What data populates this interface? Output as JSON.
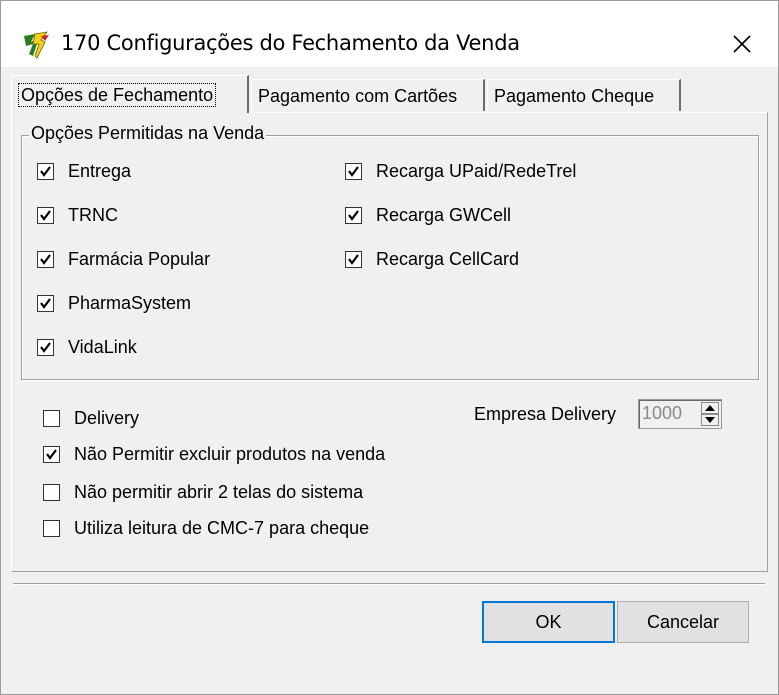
{
  "window": {
    "title": "170 Configurações do Fechamento da Venda"
  },
  "tabs": [
    {
      "label": "Opções de Fechamento",
      "active": true
    },
    {
      "label": "Pagamento com Cartões",
      "active": false
    },
    {
      "label": "Pagamento Cheque",
      "active": false
    }
  ],
  "group": {
    "legend": "Opções Permitidas na Venda",
    "left_options": [
      {
        "label": "Entrega",
        "checked": true
      },
      {
        "label": "TRNC",
        "checked": true
      },
      {
        "label": "Farmácia Popular",
        "checked": true
      },
      {
        "label": "PharmaSystem",
        "checked": true
      },
      {
        "label": "VidaLink",
        "checked": true
      }
    ],
    "right_options": [
      {
        "label": "Recarga UPaid/RedeTrel",
        "checked": true
      },
      {
        "label": "Recarga GWCell",
        "checked": true
      },
      {
        "label": "Recarga CellCard",
        "checked": true
      }
    ]
  },
  "options": [
    {
      "label": "Delivery",
      "checked": false
    },
    {
      "label": "Não Permitir excluir produtos na venda",
      "checked": true
    },
    {
      "label": "Não permitir abrir 2 telas do sistema",
      "checked": false
    },
    {
      "label": "Utiliza leitura de CMC-7 para cheque",
      "checked": false
    }
  ],
  "empresa_delivery": {
    "label": "Empresa Delivery",
    "value": "1000"
  },
  "buttons": {
    "ok": "OK",
    "cancel": "Cancelar"
  },
  "icons": {
    "app": "app-logo-icon",
    "close": "close-icon",
    "check": "checkmark-icon",
    "spin_up": "spin-up-icon",
    "spin_down": "spin-down-icon"
  }
}
